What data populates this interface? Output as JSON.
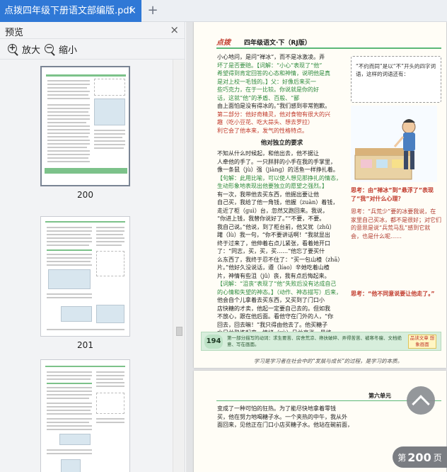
{
  "tab": {
    "title": "点拨四年级下册语文部编版.pdf",
    "close_glyph": "×",
    "new_glyph": "+"
  },
  "sidebar": {
    "title": "预览",
    "close_glyph": "×",
    "zoom_in_label": "放大",
    "zoom_out_label": "缩小",
    "thumbnails": [
      {
        "page_label": "200",
        "selected": true
      },
      {
        "page_label": "201",
        "selected": false
      },
      {
        "page_label": "",
        "selected": false
      }
    ]
  },
  "document": {
    "page1": {
      "logo": "点拨",
      "header_title": "四年级语文·下（RJ版）",
      "lines": [
        "小心地问，是问“禅冰”，而不是冰激凌。弄",
        "坏了是否要赔。【词解：“小心”表现了“他”",
        "希望得到肯定回答的心态和神情，说明他是真",
        "是对上校一毛钱的。】父：好像后来买一",
        "些巧克力，在于一比较。你说就是你的好",
        "话，这就“他”的矛盾、百般、“鄙",
        "由上面怕是没有得冰的。”我们感到非常抱歉。",
        "第二部分：他好奇精灵，他对食物有很大的兴",
        "趣（吃小豆花、吃大蒜头、想去罗拉）",
        "利它会了他本来，发气的性格特点。"
      ],
      "section_title": "他对独立的要求",
      "lines2": [
        "不知从什么时候起，和他出去，他不据让",
        "人牵他的手了。一只胖胖的小手在我的手掌里，",
        "像一条鼠（jù）强（jiàng）的活鱼一样挣扎着。",
        "【句解：此用比喻，可以使人想见那挣扎的情态，",
        "生动形象地表现出他要独立的愿望之强烈。】",
        "有一次，我带他去买东西，他掘出要让他",
        "自己买，我给了他一角钱，他握（zuàn）着钱，",
        "走近了柜（guì）台，忽然又跑回来。我说，",
        "“你进上钱，我替你说好了。”“不要，不要。",
        "我自己说。”他说，到了柜台前，他又犹（zhǔ）",
        "躇（lù）我一句，“你不要讲话啊！”我就显出",
        "终于过来了，他伸着右点儿紧张，看着她开口",
        "了：“同志，买，买，买……”他忘了要买什",
        "么东西了，我终于忍不住了：“买一包山楂（zhā）",
        "片。”他好久没说话，遵（líao）辛她吃着山楂",
        "片，神情有些沮（jǔ）丧，我有点后悔起来。",
        "【词解：“沮丧”表现了“他”失败后没有达成自己",
        "的心情和失望的神态。】（动作、神态描写）后来，",
        "他会自个儿拿着去买东西，又买到了门口小",
        "店快糖的才卖，他起一定要自己去的。但如我",
        "不放心，跟在他后面。看他守在门外的人，“你",
        "回去，回去嘛！”我只得由他去了。他买糖子",
        "水日益熟练起来。情绪（xù）日益高涨，最终"
      ],
      "think_box_text": "“不约而同”是以“不”开头的四字词语，这样的词语还有：",
      "right_notes": [
        "思考：由“禅冰”到“悬浮了”表现了“我”对什么心理？",
        "思考：“兵荒少”要的冰要我说，在家里自己买冰，都不是很好；对它们的意思是说“兵荒马乱”感到它就会，也是什么呢……",
        "思考：“他不同意说要让他走了。”"
      ],
      "page_badge": "194",
      "band_text": "第一部分描写的动词：求生要苦、房舍荒凉、搀扶破碎、弄得苦苦、被寒冬瘦、文档绝意、写在画面。",
      "band_stamp": "品读文章 想象画面",
      "footnote": "学习是学习者在社会中的“发展与成长”的过程，是学习的本质。"
    },
    "page2": {
      "unit_label": "第六单元",
      "lines": [
        "变成了一种可怕的狂热。为了能尽快地拿着零钱",
        "买，他在努力地喝糖子水。一个夹热的中午，我从外",
        "面回来，见他正在门口小店买糖子水。他站在碗前面，"
      ]
    }
  },
  "floating": {
    "scroll_top_icon": "chevron-up",
    "page_prefix": "第",
    "page_number": "200",
    "page_suffix": "页"
  }
}
